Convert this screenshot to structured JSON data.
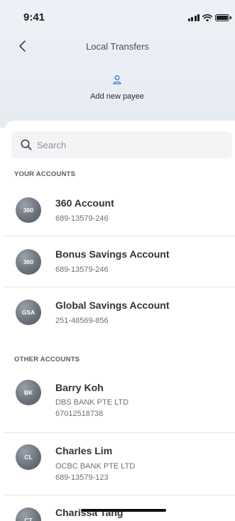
{
  "status_bar": {
    "time": "9:41"
  },
  "nav": {
    "title": "Local Transfers",
    "back_icon": "chevron-left-icon"
  },
  "add_payee": {
    "label": "Add new payee",
    "icon": "user-icon",
    "accent": "#3a7bd5"
  },
  "search": {
    "placeholder": "Search",
    "value": ""
  },
  "sections": {
    "your_accounts": {
      "label": "YOUR ACCOUNTS",
      "items": [
        {
          "initials": "360",
          "name": "360 Account",
          "number": "689-13579-246"
        },
        {
          "initials": "360",
          "name": "Bonus Savings Account",
          "number": "689-13579-246"
        },
        {
          "initials": "GSA",
          "name": "Global Savings Account",
          "number": "251-48569-856"
        }
      ]
    },
    "other_accounts": {
      "label": "OTHER ACCOUNTS",
      "items": [
        {
          "initials": "BK",
          "name": "Barry Koh",
          "bank": "DBS BANK PTE LTD",
          "number": "67012518738"
        },
        {
          "initials": "CL",
          "name": "Charles Lim",
          "bank": "OCBC BANK PTE LTD",
          "number": "689-13579-123"
        },
        {
          "initials": "CT",
          "name": "Charissa Tang"
        }
      ]
    }
  }
}
